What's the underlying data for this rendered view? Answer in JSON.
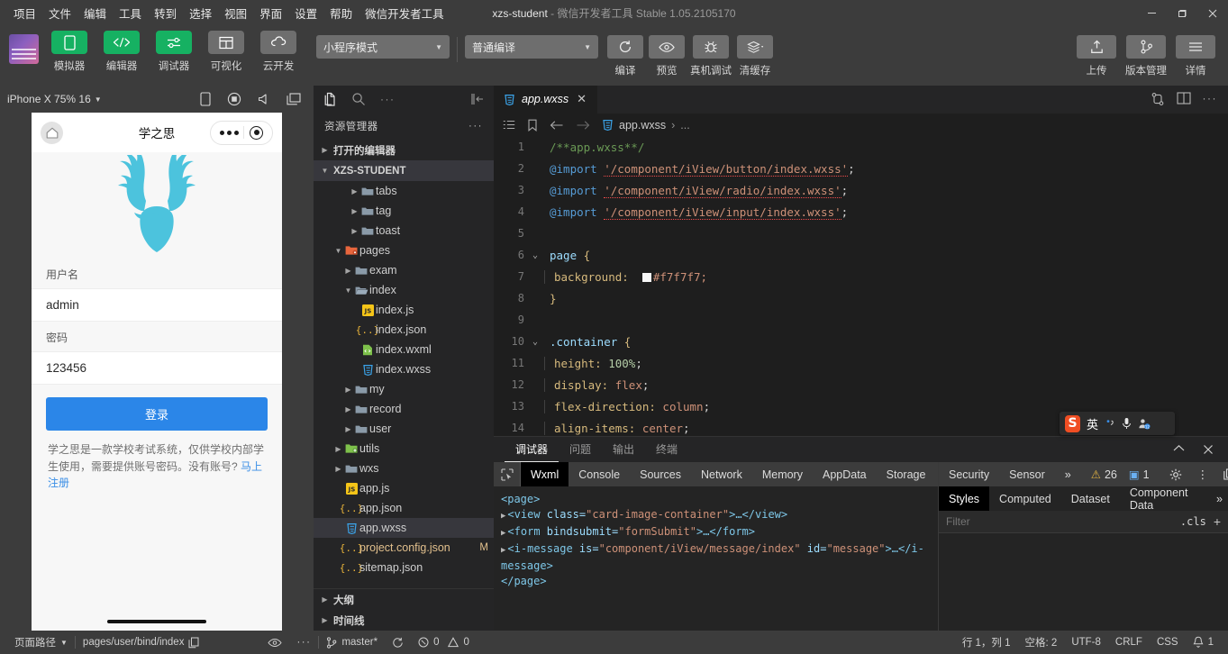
{
  "window": {
    "title_project": "xzs-student",
    "title_dash": " - ",
    "title_app": "微信开发者工具",
    "title_version": "Stable 1.05.2105170",
    "minimize": "minimize-icon",
    "maximize": "maximize-icon",
    "close": "close-icon"
  },
  "menubar": {
    "items": [
      {
        "label": "项目"
      },
      {
        "label": "文件"
      },
      {
        "label": "编辑"
      },
      {
        "label": "工具"
      },
      {
        "label": "转到"
      },
      {
        "label": "选择"
      },
      {
        "label": "视图"
      },
      {
        "label": "界面"
      },
      {
        "label": "设置"
      },
      {
        "label": "帮助"
      },
      {
        "label": "微信开发者工具"
      }
    ]
  },
  "toolbar": {
    "panel_toggles": [
      {
        "label": "模拟器",
        "icon": "phone-icon",
        "active": true
      },
      {
        "label": "编辑器",
        "icon": "code-icon",
        "active": true
      },
      {
        "label": "调试器",
        "icon": "sliders-icon",
        "active": true
      },
      {
        "label": "可视化",
        "icon": "layout-icon",
        "active": false
      },
      {
        "label": "云开发",
        "icon": "cloud-icon",
        "active": false
      }
    ],
    "mode_select": {
      "value": "小程序模式",
      "caret": "chevron-down-icon"
    },
    "compile_select": {
      "value": "普通编译",
      "caret": "chevron-down-icon"
    },
    "actions": [
      {
        "label": "编译",
        "icon": "refresh-icon"
      },
      {
        "label": "预览",
        "icon": "eye-icon"
      },
      {
        "label": "真机调试",
        "icon": "bug-icon"
      },
      {
        "label": "清缓存",
        "icon": "layers-icon"
      }
    ],
    "right_actions": [
      {
        "label": "上传",
        "icon": "upload-icon"
      },
      {
        "label": "版本管理",
        "icon": "git-branch-icon"
      },
      {
        "label": "详情",
        "icon": "hamburger-icon"
      }
    ]
  },
  "simulator": {
    "device": "iPhone X 75% 16",
    "device_caret": "chevron-down-icon",
    "bar_icons": [
      "rotate-device-icon",
      "record-icon",
      "volume-icon",
      "multi-window-icon"
    ],
    "page": {
      "nav_title": "学之思",
      "home_icon": "home-icon",
      "capsule_more": "more-dots-icon",
      "capsule_target": "target-icon",
      "logo_icon": "deer-logo",
      "logo_color": "#4cc3dd",
      "fields": [
        {
          "label": "用户名",
          "value": "admin"
        },
        {
          "label": "密码",
          "value": "123456"
        }
      ],
      "login_button": "登录",
      "login_button_color": "#2b86e8",
      "hint_text": "学之思是一款学校考试系统，仅供学校内部学生使用，需要提供账号密码。没有账号? ",
      "hint_link": "马上注册"
    }
  },
  "explorer": {
    "activity_icons": [
      "files-icon",
      "search-icon",
      "more-dots-icon",
      "collapse-sidebar-icon"
    ],
    "header": "资源管理器",
    "header_more": "more-dots-icon",
    "open_editors": "打开的编辑器",
    "project_root": "XZS-STUDENT",
    "tree": [
      {
        "label": "tabs",
        "type": "folder",
        "depth": 3,
        "expanded": false
      },
      {
        "label": "tag",
        "type": "folder",
        "depth": 3,
        "expanded": false
      },
      {
        "label": "toast",
        "type": "folder",
        "depth": 3,
        "expanded": false
      },
      {
        "label": "pages",
        "type": "folder-pages",
        "depth": 2,
        "expanded": true
      },
      {
        "label": "exam",
        "type": "folder",
        "depth": 3,
        "expanded": false
      },
      {
        "label": "index",
        "type": "folder-open",
        "depth": 3,
        "expanded": true
      },
      {
        "label": "index.js",
        "type": "js",
        "depth": 4
      },
      {
        "label": "index.json",
        "type": "json",
        "depth": 4
      },
      {
        "label": "index.wxml",
        "type": "wxml",
        "depth": 4
      },
      {
        "label": "index.wxss",
        "type": "wxss",
        "depth": 4
      },
      {
        "label": "my",
        "type": "folder",
        "depth": 3,
        "expanded": false
      },
      {
        "label": "record",
        "type": "folder",
        "depth": 3,
        "expanded": false
      },
      {
        "label": "user",
        "type": "folder",
        "depth": 3,
        "expanded": false
      },
      {
        "label": "utils",
        "type": "folder-utils",
        "depth": 2,
        "expanded": false
      },
      {
        "label": "wxs",
        "type": "folder",
        "depth": 2,
        "expanded": false
      },
      {
        "label": "app.js",
        "type": "js",
        "depth": 2
      },
      {
        "label": "app.json",
        "type": "json",
        "depth": 2
      },
      {
        "label": "app.wxss",
        "type": "wxss",
        "depth": 2,
        "selected": true
      },
      {
        "label": "project.config.json",
        "type": "json",
        "depth": 2,
        "badge": "M"
      },
      {
        "label": "sitemap.json",
        "type": "json",
        "depth": 2
      }
    ],
    "bottom_sections": [
      {
        "label": "大纲"
      },
      {
        "label": "时间线"
      }
    ]
  },
  "editor": {
    "tab": {
      "name": "app.wxss",
      "icon": "wxss-file-icon",
      "close": "close-icon"
    },
    "tab_actions": [
      "split-direction-icon",
      "split-editor-icon",
      "more-dots-icon"
    ],
    "breadcrumb_icons": [
      "outline-icon",
      "bookmark-icon",
      "back-arrow-icon",
      "forward-arrow-icon"
    ],
    "breadcrumb_file": "app.wxss",
    "breadcrumb_sep": "›",
    "breadcrumb_more": "...",
    "lines": [
      {
        "n": 1,
        "fold": "",
        "text": "/**app.wxss**/"
      },
      {
        "n": 2,
        "fold": "",
        "text": "@import '/component/iView/button/index.wxss';"
      },
      {
        "n": 3,
        "fold": "",
        "text": "@import '/component/iView/radio/index.wxss';"
      },
      {
        "n": 4,
        "fold": "",
        "text": "@import '/component/iView/input/index.wxss';"
      },
      {
        "n": 5,
        "fold": "",
        "text": ""
      },
      {
        "n": 6,
        "fold": "v",
        "text": "page {"
      },
      {
        "n": 7,
        "fold": "",
        "text": "  background: #f7f7f7;"
      },
      {
        "n": 8,
        "fold": "",
        "text": "}"
      },
      {
        "n": 9,
        "fold": "",
        "text": ""
      },
      {
        "n": 10,
        "fold": "v",
        "text": ".container {"
      },
      {
        "n": 11,
        "fold": "",
        "text": "  height: 100%;"
      },
      {
        "n": 12,
        "fold": "",
        "text": "  display: flex;"
      },
      {
        "n": 13,
        "fold": "",
        "text": "  flex-direction: column;"
      },
      {
        "n": 14,
        "fold": "",
        "text": "  align-items: center;"
      }
    ],
    "code_tokens": {
      "comment": "/**app.wxss**/",
      "import_kw": "@import",
      "import_paths": [
        "'/component/iView/button/index.wxss'",
        "'/component/iView/radio/index.wxss'",
        "'/component/iView/input/index.wxss'"
      ],
      "semicolon": ";",
      "page_sel": "page",
      "brace_open": "{",
      "brace_close": "}",
      "bg_prop": "background:",
      "bg_value": "#f7f7f7;",
      "container_sel": ".container",
      "decls": [
        {
          "prop": "height:",
          "value": "100%",
          "end": ";"
        },
        {
          "prop": "display:",
          "value": "flex",
          "end": ";"
        },
        {
          "prop": "flex-direction:",
          "value": "column",
          "end": ";"
        },
        {
          "prop": "align-items:",
          "value": "center",
          "end": ";"
        }
      ]
    }
  },
  "debugger": {
    "panel_tabs": [
      {
        "label": "调试器",
        "active": true
      },
      {
        "label": "问题",
        "active": false
      },
      {
        "label": "输出",
        "active": false
      },
      {
        "label": "终端",
        "active": false
      }
    ],
    "panel_controls": [
      "chevron-up-icon",
      "close-icon"
    ],
    "devtools_tabs": [
      {
        "label": "Wxml",
        "active": true
      },
      {
        "label": "Console",
        "active": false
      },
      {
        "label": "Sources",
        "active": false
      },
      {
        "label": "Network",
        "active": false
      },
      {
        "label": "Memory",
        "active": false
      },
      {
        "label": "AppData",
        "active": false
      },
      {
        "label": "Storage",
        "active": false
      },
      {
        "label": "Security",
        "active": false
      },
      {
        "label": "Sensor",
        "active": false
      }
    ],
    "devtools_overflow": "»",
    "warning_count": "26",
    "info_count": "1",
    "devtools_icons": [
      "gear-icon",
      "kebab-menu-icon",
      "dock-icon"
    ],
    "inspect_icon": "inspect-element-icon",
    "dom": {
      "line1": "<page>",
      "line2_tag": "<view",
      "line2_attr": "class=",
      "line2_val": "\"card-image-container\"",
      "line2_close": ">…</view>",
      "line3_tag": "<form",
      "line3_attr": "bindsubmit=",
      "line3_val": "\"formSubmit\"",
      "line3_close": ">…</form>",
      "line4_tag": "<i-message",
      "line4_attr": "is=",
      "line4_val": "\"component/iView/message/index\"",
      "line4_attr2": "id=",
      "line4_val2": "\"message\"",
      "line4_close": ">…</i-message>",
      "line5": "</page>"
    },
    "styles_tabs": [
      {
        "label": "Styles",
        "active": true
      },
      {
        "label": "Computed",
        "active": false
      },
      {
        "label": "Dataset",
        "active": false
      },
      {
        "label": "Component Data",
        "active": false
      }
    ],
    "styles_overflow": "»",
    "filter_placeholder": "Filter",
    "cls_label": ".cls",
    "add_rule": "+"
  },
  "statusbar": {
    "page_path_label": "页面路径",
    "page_path_caret": "chevron-down-icon",
    "page_path_value": "pages/user/bind/index",
    "copy_icon": "copy-icon",
    "eye_icon": "eye-icon",
    "more_icon": "more-dots-icon",
    "branch_icon": "git-branch-icon",
    "branch": "master*",
    "sync_icon": "sync-icon",
    "error_icon": "error-icon",
    "error_count": "0",
    "warn_icon": "warning-icon",
    "warn_count": "0",
    "cursor": "行 1，列 1",
    "spaces": "空格: 2",
    "encoding": "UTF-8",
    "eol": "CRLF",
    "language": "CSS",
    "bell_icon": "bell-icon",
    "bell_count": "1"
  },
  "ime": {
    "logo": "S",
    "mode": "英",
    "punct_icon": "punctuation-icon",
    "mic_icon": "microphone-icon",
    "user_icon": "user-panel-icon",
    "grid_icon": "toolbox-icon"
  }
}
